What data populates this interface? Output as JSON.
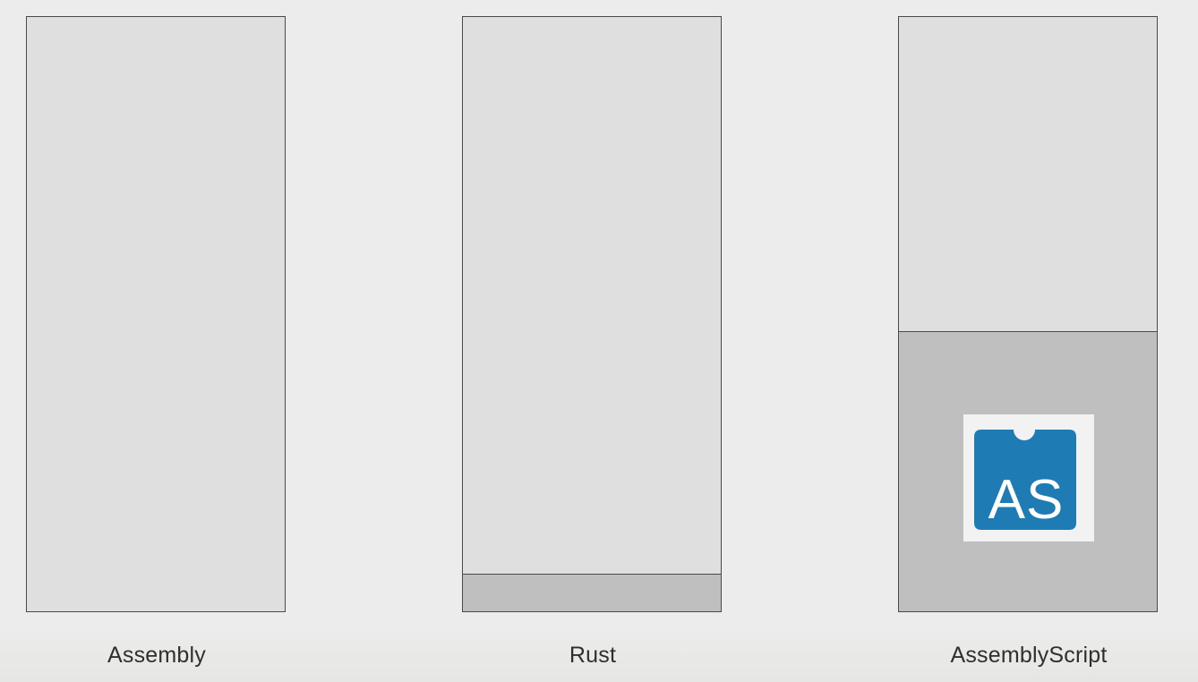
{
  "columns": [
    {
      "id": "assembly",
      "label": "Assembly",
      "filled_fraction": 0
    },
    {
      "id": "rust",
      "label": "Rust",
      "filled_fraction": 0.063
    },
    {
      "id": "assemblyscript",
      "label": "AssemblyScript",
      "filled_fraction": 0.47
    }
  ],
  "logo": {
    "text": "AS",
    "icon": "assemblyscript-logo-icon",
    "color": "#1f7bb3",
    "background": "#f2f2f2"
  },
  "colors": {
    "page_background": "#ececec",
    "box_light": "#dfdfdf",
    "box_dark": "#bfbfbf",
    "border": "#4a4a4a",
    "caption": "#2f2f2f"
  }
}
